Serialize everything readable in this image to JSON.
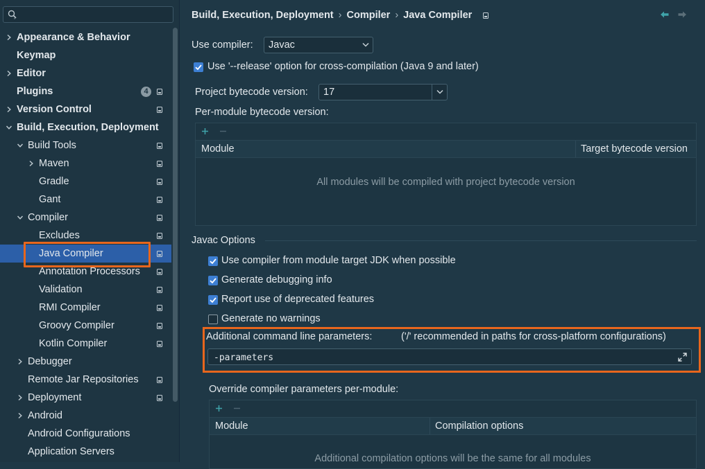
{
  "sidebar": {
    "search": {
      "value": "",
      "placeholder": ""
    },
    "items": [
      {
        "label": "Appearance & Behavior",
        "bold": true,
        "expandable": true,
        "expanded": false,
        "level": 0
      },
      {
        "label": "Keymap",
        "bold": true,
        "expandable": false,
        "level": 0
      },
      {
        "label": "Editor",
        "bold": true,
        "expandable": true,
        "expanded": false,
        "level": 0
      },
      {
        "label": "Plugins",
        "bold": true,
        "expandable": false,
        "level": 0,
        "badge": "4",
        "settings_icon": true
      },
      {
        "label": "Version Control",
        "bold": true,
        "expandable": true,
        "expanded": false,
        "level": 0,
        "settings_icon": true
      },
      {
        "label": "Build, Execution, Deployment",
        "bold": true,
        "expandable": true,
        "expanded": true,
        "level": 0
      },
      {
        "label": "Build Tools",
        "expandable": true,
        "expanded": true,
        "level": 1,
        "settings_icon": true
      },
      {
        "label": "Maven",
        "expandable": true,
        "expanded": false,
        "level": 2,
        "settings_icon": true
      },
      {
        "label": "Gradle",
        "expandable": false,
        "level": 2,
        "settings_icon": true
      },
      {
        "label": "Gant",
        "expandable": false,
        "level": 2,
        "settings_icon": true
      },
      {
        "label": "Compiler",
        "expandable": true,
        "expanded": true,
        "level": 1,
        "settings_icon": true
      },
      {
        "label": "Excludes",
        "expandable": false,
        "level": 2,
        "settings_icon": true
      },
      {
        "label": "Java Compiler",
        "expandable": false,
        "level": 2,
        "settings_icon": true,
        "selected": true
      },
      {
        "label": "Annotation Processors",
        "expandable": false,
        "level": 2,
        "settings_icon": true
      },
      {
        "label": "Validation",
        "expandable": false,
        "level": 2,
        "settings_icon": true
      },
      {
        "label": "RMI Compiler",
        "expandable": false,
        "level": 2,
        "settings_icon": true
      },
      {
        "label": "Groovy Compiler",
        "expandable": false,
        "level": 2,
        "settings_icon": true
      },
      {
        "label": "Kotlin Compiler",
        "expandable": false,
        "level": 2,
        "settings_icon": true
      },
      {
        "label": "Debugger",
        "expandable": true,
        "expanded": false,
        "level": 1
      },
      {
        "label": "Remote Jar Repositories",
        "expandable": false,
        "level": 1,
        "settings_icon": true
      },
      {
        "label": "Deployment",
        "expandable": true,
        "expanded": false,
        "level": 1,
        "settings_icon": true
      },
      {
        "label": "Android",
        "expandable": true,
        "expanded": false,
        "level": 1
      },
      {
        "label": "Android Configurations",
        "expandable": false,
        "level": 1
      },
      {
        "label": "Application Servers",
        "expandable": false,
        "level": 1
      }
    ]
  },
  "breadcrumb": [
    "Build, Execution, Deployment",
    "Compiler",
    "Java Compiler"
  ],
  "compiler": {
    "use_compiler_label": "Use compiler:",
    "use_compiler_value": "Javac",
    "release_option_label": "Use '--release' option for cross-compilation (Java 9 and later)",
    "release_option_checked": true,
    "project_bytecode_label": "Project bytecode version:",
    "project_bytecode_value": "17",
    "per_module_label": "Per-module bytecode version:",
    "per_module_table": {
      "columns": [
        "Module",
        "Target bytecode version"
      ],
      "empty_text": "All modules will be compiled with project bytecode version"
    }
  },
  "javac_options": {
    "group_label": "Javac Options",
    "checkboxes": [
      {
        "label": "Use compiler from module target JDK when possible",
        "checked": true
      },
      {
        "label": "Generate debugging info",
        "checked": true
      },
      {
        "label": "Report use of deprecated features",
        "checked": true
      },
      {
        "label": "Generate no warnings",
        "checked": false
      }
    ],
    "additional_params_label": "Additional command line parameters:",
    "additional_params_hint": "('/' recommended in paths for cross-platform configurations)",
    "additional_params_value": "-parameters",
    "override_label": "Override compiler parameters per-module:",
    "override_table": {
      "columns": [
        "Module",
        "Compilation options"
      ],
      "empty_text": "Additional compilation options will be the same for all modules"
    }
  },
  "colors": {
    "background": "#1f3846",
    "selection": "#2c5fa8",
    "highlight": "#e8661d",
    "checkbox": "#3d7fd3",
    "nav_arrow": "#3fa3a9"
  }
}
